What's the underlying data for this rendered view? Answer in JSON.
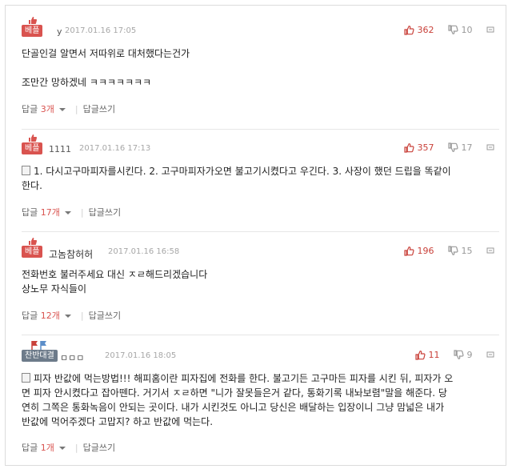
{
  "comments": [
    {
      "badge": "베플",
      "nickname": "y",
      "date": "2017.01.16 17:05",
      "up": "362",
      "down": "10",
      "lines": [
        "단골인걸 알면서 저따위로 대처했다는건가",
        "",
        "조만간 망하겠네 ㅋㅋㅋㅋㅋㅋㅋ"
      ],
      "reply_label": "답글",
      "reply_count": "3개",
      "write_reply": "답글쓰기"
    },
    {
      "badge": "베플",
      "nickname": "1111",
      "date": "2017.01.16 17:13",
      "up": "357",
      "down": "17",
      "lines": [
        "1. 다시고구마피자를시킨다. 2. 고구마피자가오면 불고기시켰다고 우긴다. 3. 사장이 했던 드립을 똑같이",
        "한다."
      ],
      "reply_label": "답글",
      "reply_count": "17개",
      "write_reply": "답글쓰기"
    },
    {
      "badge": "베플",
      "nickname": "고놈참허허",
      "date": "2017.01.16 16:58",
      "up": "196",
      "down": "15",
      "lines": [
        "전화번호 불러주세요 대신 ㅈㄹ해드리겠습니다",
        "상노무 자식들이"
      ],
      "reply_label": "답글",
      "reply_count": "12개",
      "write_reply": "답글쓰기"
    },
    {
      "badge": "찬반대결",
      "nickname": "ㅁㅁㅁ",
      "date": "2017.01.16 18:05",
      "up": "11",
      "down": "9",
      "lines": [
        "피자 반값에 먹는방법!!! 해피홈이란 피자집에 전화를 한다. 불고기든 고구마든 피자를 시킨 뒤, 피자가 오",
        "면 피자 안시켰다고 잡아뗀다. 거기서 ㅈㄹ하면 \"니가 잘못들은거 같다, 통화기록 내놔보렴\"말을 해준다. 당",
        "연히 그쪽은 통화녹음이 안되는 곳이다. 내가 시킨것도 아니고 당신은 배달하는 입장이니 그냥 맘넓은 내가",
        "반값에 먹어주겠다 고맙지? 하고 반값에 먹는다."
      ],
      "reply_label": "답글",
      "reply_count": "1개",
      "write_reply": "답글쓰기"
    }
  ],
  "colors": {
    "accent": "#d9534f",
    "muted": "#a7a7a7",
    "versus_badge": "#6d7b8a"
  }
}
